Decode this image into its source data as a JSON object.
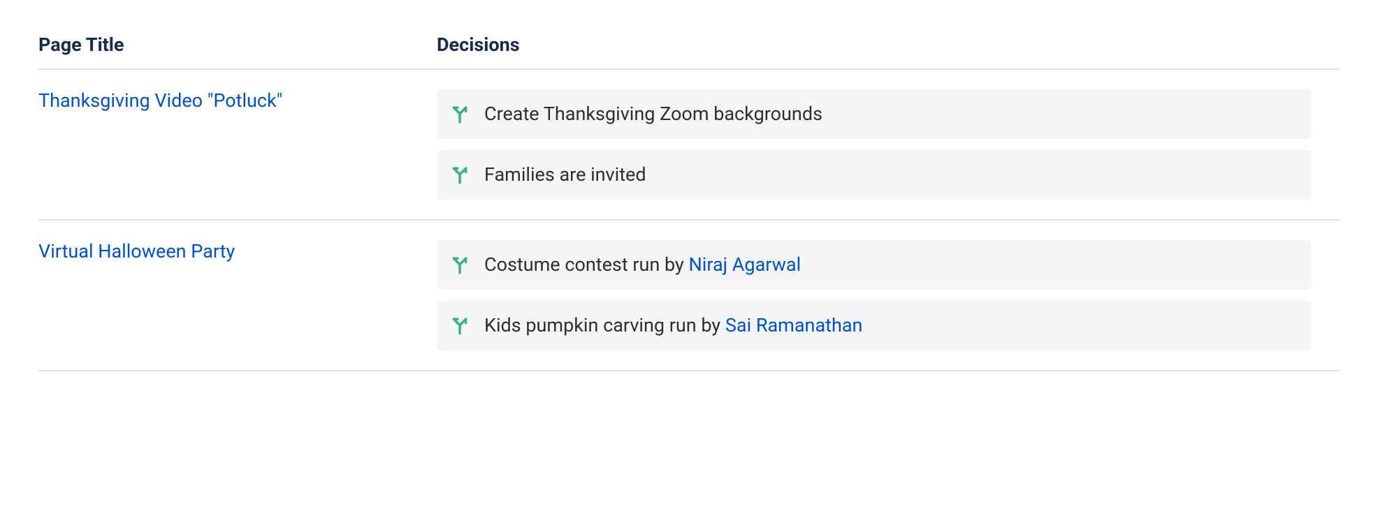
{
  "headers": {
    "page_title": "Page Title",
    "decisions": "Decisions"
  },
  "rows": [
    {
      "page_title": "Thanksgiving Video \"Potluck\"",
      "decisions": [
        {
          "prefix": "Create Thanksgiving Zoom backgrounds",
          "user": null,
          "suffix": ""
        },
        {
          "prefix": "Families are invited",
          "user": null,
          "suffix": ""
        }
      ]
    },
    {
      "page_title": "Virtual Halloween Party",
      "decisions": [
        {
          "prefix": "Costume contest run by ",
          "user": "Niraj Agarwal",
          "suffix": ""
        },
        {
          "prefix": "Kids pumpkin carving run by ",
          "user": "Sai Ramanathan",
          "suffix": ""
        }
      ]
    }
  ],
  "colors": {
    "link": "#0052CC",
    "decision_bg": "#F4F5F7",
    "border": "#DFE1E6",
    "text": "#172B4D",
    "icon": "#36B37E"
  }
}
